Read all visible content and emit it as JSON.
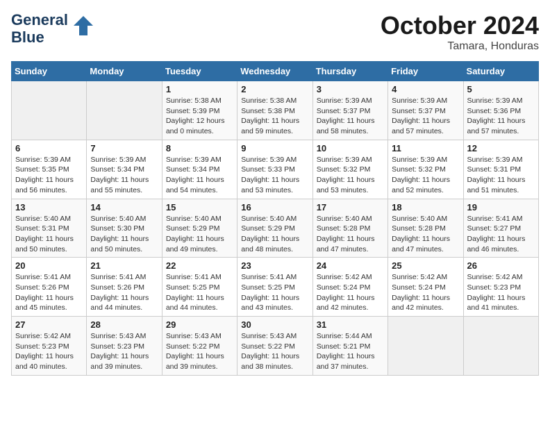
{
  "header": {
    "logo_line1": "General",
    "logo_line2": "Blue",
    "month": "October 2024",
    "location": "Tamara, Honduras"
  },
  "days_of_week": [
    "Sunday",
    "Monday",
    "Tuesday",
    "Wednesday",
    "Thursday",
    "Friday",
    "Saturday"
  ],
  "weeks": [
    [
      {
        "day": "",
        "info": ""
      },
      {
        "day": "",
        "info": ""
      },
      {
        "day": "1",
        "info": "Sunrise: 5:38 AM\nSunset: 5:39 PM\nDaylight: 12 hours\nand 0 minutes."
      },
      {
        "day": "2",
        "info": "Sunrise: 5:38 AM\nSunset: 5:38 PM\nDaylight: 11 hours\nand 59 minutes."
      },
      {
        "day": "3",
        "info": "Sunrise: 5:39 AM\nSunset: 5:37 PM\nDaylight: 11 hours\nand 58 minutes."
      },
      {
        "day": "4",
        "info": "Sunrise: 5:39 AM\nSunset: 5:37 PM\nDaylight: 11 hours\nand 57 minutes."
      },
      {
        "day": "5",
        "info": "Sunrise: 5:39 AM\nSunset: 5:36 PM\nDaylight: 11 hours\nand 57 minutes."
      }
    ],
    [
      {
        "day": "6",
        "info": "Sunrise: 5:39 AM\nSunset: 5:35 PM\nDaylight: 11 hours\nand 56 minutes."
      },
      {
        "day": "7",
        "info": "Sunrise: 5:39 AM\nSunset: 5:34 PM\nDaylight: 11 hours\nand 55 minutes."
      },
      {
        "day": "8",
        "info": "Sunrise: 5:39 AM\nSunset: 5:34 PM\nDaylight: 11 hours\nand 54 minutes."
      },
      {
        "day": "9",
        "info": "Sunrise: 5:39 AM\nSunset: 5:33 PM\nDaylight: 11 hours\nand 53 minutes."
      },
      {
        "day": "10",
        "info": "Sunrise: 5:39 AM\nSunset: 5:32 PM\nDaylight: 11 hours\nand 53 minutes."
      },
      {
        "day": "11",
        "info": "Sunrise: 5:39 AM\nSunset: 5:32 PM\nDaylight: 11 hours\nand 52 minutes."
      },
      {
        "day": "12",
        "info": "Sunrise: 5:39 AM\nSunset: 5:31 PM\nDaylight: 11 hours\nand 51 minutes."
      }
    ],
    [
      {
        "day": "13",
        "info": "Sunrise: 5:40 AM\nSunset: 5:31 PM\nDaylight: 11 hours\nand 50 minutes."
      },
      {
        "day": "14",
        "info": "Sunrise: 5:40 AM\nSunset: 5:30 PM\nDaylight: 11 hours\nand 50 minutes."
      },
      {
        "day": "15",
        "info": "Sunrise: 5:40 AM\nSunset: 5:29 PM\nDaylight: 11 hours\nand 49 minutes."
      },
      {
        "day": "16",
        "info": "Sunrise: 5:40 AM\nSunset: 5:29 PM\nDaylight: 11 hours\nand 48 minutes."
      },
      {
        "day": "17",
        "info": "Sunrise: 5:40 AM\nSunset: 5:28 PM\nDaylight: 11 hours\nand 47 minutes."
      },
      {
        "day": "18",
        "info": "Sunrise: 5:40 AM\nSunset: 5:28 PM\nDaylight: 11 hours\nand 47 minutes."
      },
      {
        "day": "19",
        "info": "Sunrise: 5:41 AM\nSunset: 5:27 PM\nDaylight: 11 hours\nand 46 minutes."
      }
    ],
    [
      {
        "day": "20",
        "info": "Sunrise: 5:41 AM\nSunset: 5:26 PM\nDaylight: 11 hours\nand 45 minutes."
      },
      {
        "day": "21",
        "info": "Sunrise: 5:41 AM\nSunset: 5:26 PM\nDaylight: 11 hours\nand 44 minutes."
      },
      {
        "day": "22",
        "info": "Sunrise: 5:41 AM\nSunset: 5:25 PM\nDaylight: 11 hours\nand 44 minutes."
      },
      {
        "day": "23",
        "info": "Sunrise: 5:41 AM\nSunset: 5:25 PM\nDaylight: 11 hours\nand 43 minutes."
      },
      {
        "day": "24",
        "info": "Sunrise: 5:42 AM\nSunset: 5:24 PM\nDaylight: 11 hours\nand 42 minutes."
      },
      {
        "day": "25",
        "info": "Sunrise: 5:42 AM\nSunset: 5:24 PM\nDaylight: 11 hours\nand 42 minutes."
      },
      {
        "day": "26",
        "info": "Sunrise: 5:42 AM\nSunset: 5:23 PM\nDaylight: 11 hours\nand 41 minutes."
      }
    ],
    [
      {
        "day": "27",
        "info": "Sunrise: 5:42 AM\nSunset: 5:23 PM\nDaylight: 11 hours\nand 40 minutes."
      },
      {
        "day": "28",
        "info": "Sunrise: 5:43 AM\nSunset: 5:23 PM\nDaylight: 11 hours\nand 39 minutes."
      },
      {
        "day": "29",
        "info": "Sunrise: 5:43 AM\nSunset: 5:22 PM\nDaylight: 11 hours\nand 39 minutes."
      },
      {
        "day": "30",
        "info": "Sunrise: 5:43 AM\nSunset: 5:22 PM\nDaylight: 11 hours\nand 38 minutes."
      },
      {
        "day": "31",
        "info": "Sunrise: 5:44 AM\nSunset: 5:21 PM\nDaylight: 11 hours\nand 37 minutes."
      },
      {
        "day": "",
        "info": ""
      },
      {
        "day": "",
        "info": ""
      }
    ]
  ]
}
